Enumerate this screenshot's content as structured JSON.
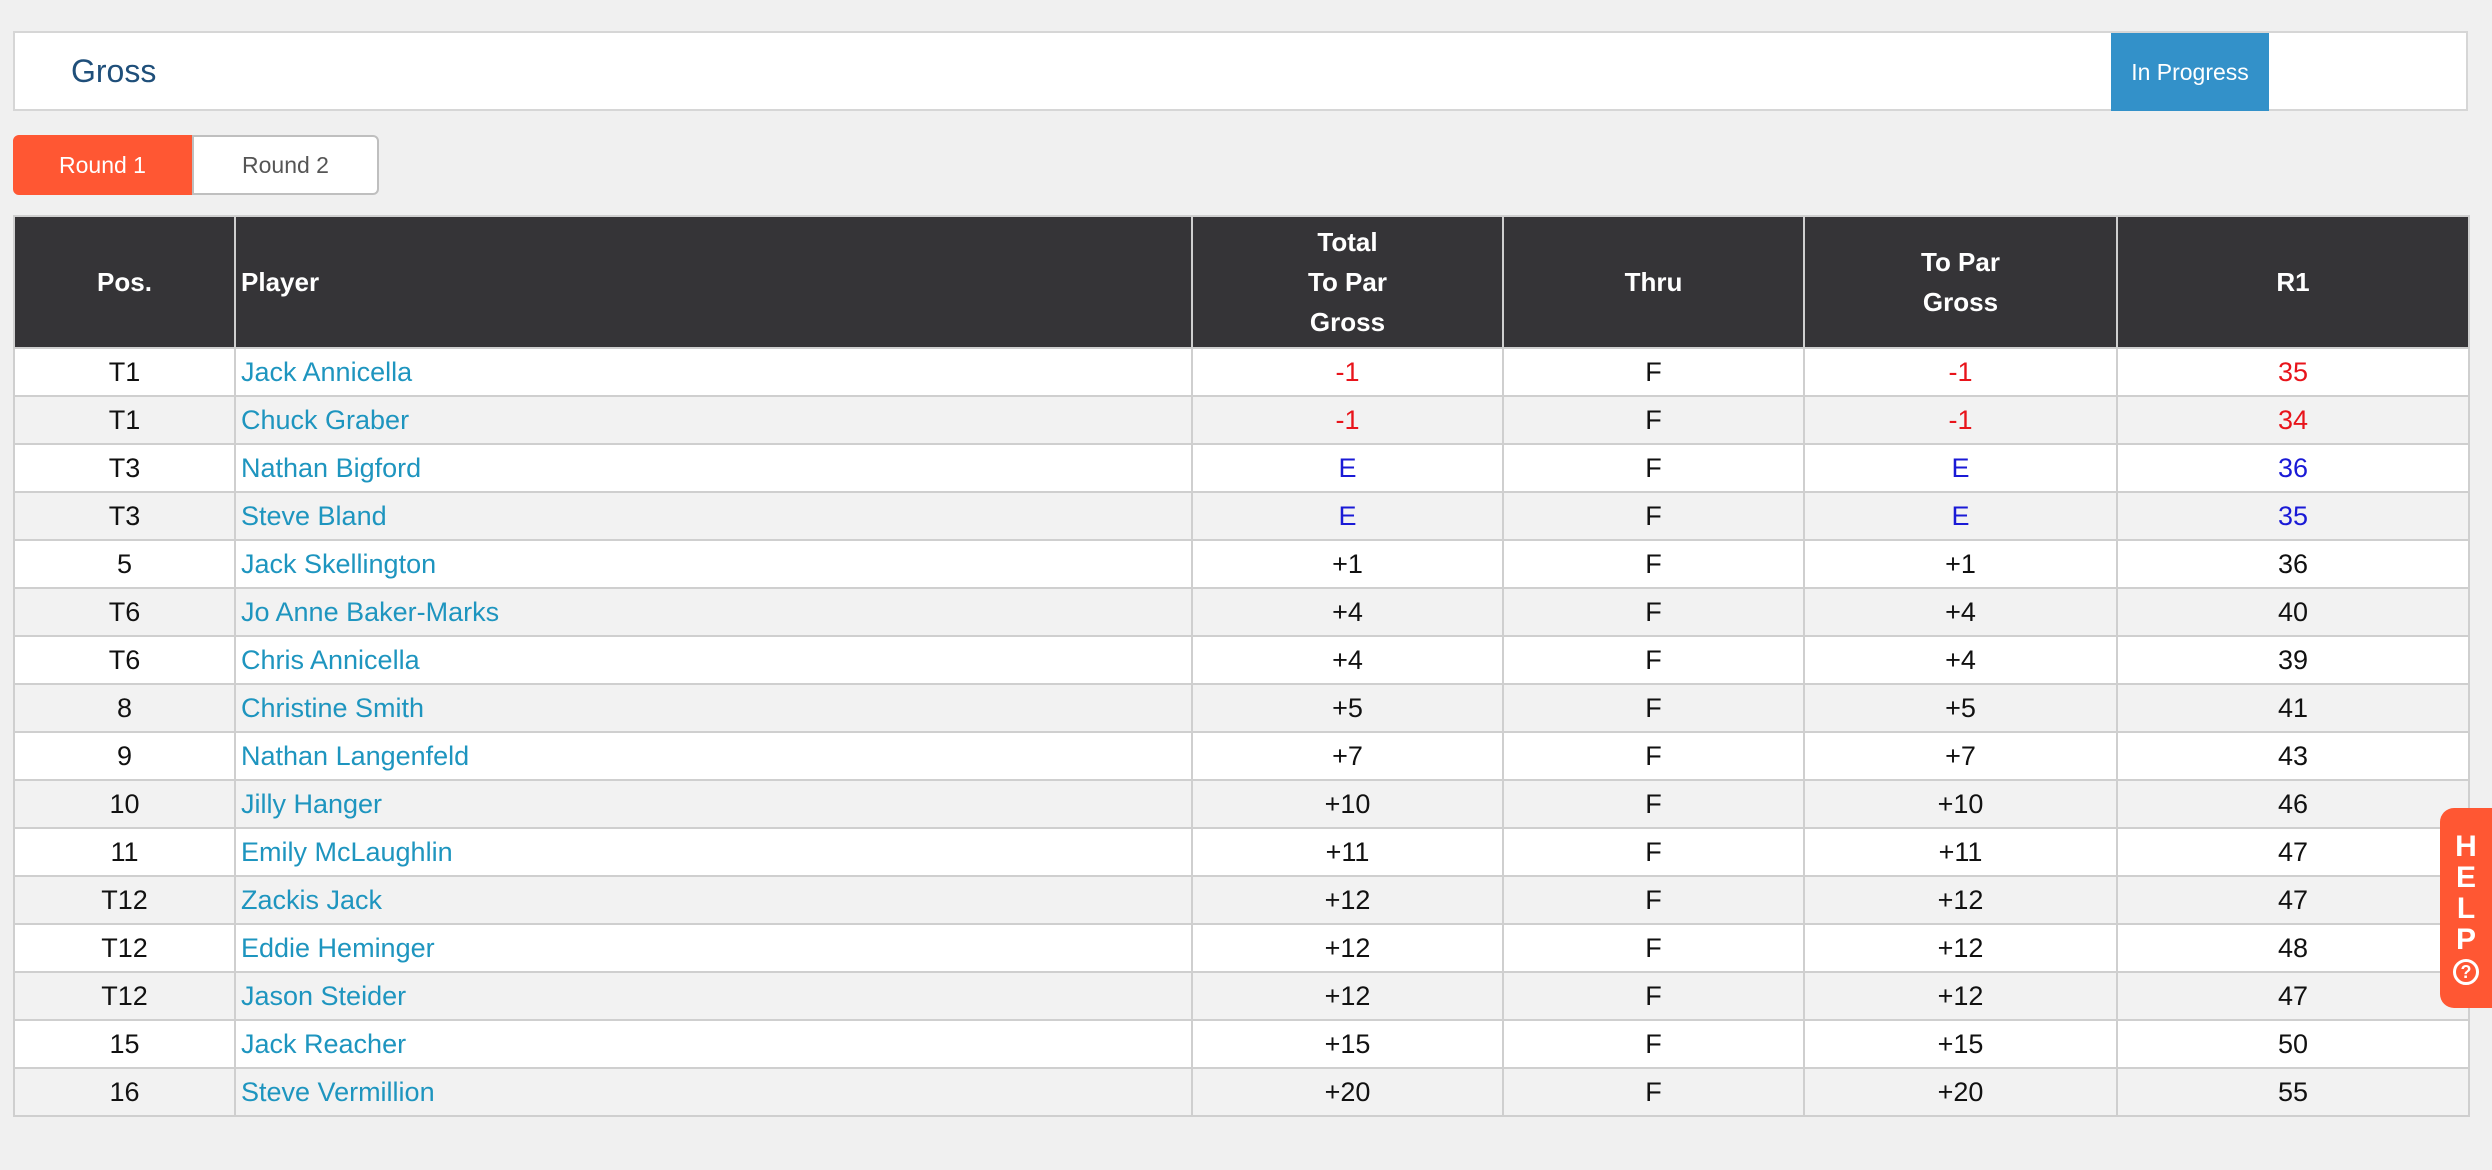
{
  "header": {
    "title": "Gross",
    "status": "In Progress"
  },
  "round_tabs": [
    {
      "label": "Round 1",
      "active": true
    },
    {
      "label": "Round 2",
      "active": false
    }
  ],
  "table": {
    "columns": {
      "pos": "Pos.",
      "player": "Player",
      "total_line1": "Total",
      "total_line2": "To Par",
      "total_line3": "Gross",
      "thru": "Thru",
      "topar_line1": "To Par",
      "topar_line2": "Gross",
      "r1": "R1"
    },
    "rows": [
      {
        "pos": "T1",
        "player": "Jack Annicella",
        "total": "-1",
        "thru": "F",
        "to_par": "-1",
        "r1": "35",
        "score_status": "under"
      },
      {
        "pos": "T1",
        "player": "Chuck Graber",
        "total": "-1",
        "thru": "F",
        "to_par": "-1",
        "r1": "34",
        "score_status": "under"
      },
      {
        "pos": "T3",
        "player": "Nathan Bigford",
        "total": "E",
        "thru": "F",
        "to_par": "E",
        "r1": "36",
        "score_status": "even"
      },
      {
        "pos": "T3",
        "player": "Steve Bland",
        "total": "E",
        "thru": "F",
        "to_par": "E",
        "r1": "35",
        "score_status": "even"
      },
      {
        "pos": "5",
        "player": "Jack Skellington",
        "total": "+1",
        "thru": "F",
        "to_par": "+1",
        "r1": "36",
        "score_status": "over"
      },
      {
        "pos": "T6",
        "player": "Jo Anne Baker-Marks",
        "total": "+4",
        "thru": "F",
        "to_par": "+4",
        "r1": "40",
        "score_status": "over"
      },
      {
        "pos": "T6",
        "player": "Chris Annicella",
        "total": "+4",
        "thru": "F",
        "to_par": "+4",
        "r1": "39",
        "score_status": "over"
      },
      {
        "pos": "8",
        "player": "Christine Smith",
        "total": "+5",
        "thru": "F",
        "to_par": "+5",
        "r1": "41",
        "score_status": "over"
      },
      {
        "pos": "9",
        "player": "Nathan Langenfeld",
        "total": "+7",
        "thru": "F",
        "to_par": "+7",
        "r1": "43",
        "score_status": "over"
      },
      {
        "pos": "10",
        "player": "Jilly Hanger",
        "total": "+10",
        "thru": "F",
        "to_par": "+10",
        "r1": "46",
        "score_status": "over"
      },
      {
        "pos": "11",
        "player": "Emily McLaughlin",
        "total": "+11",
        "thru": "F",
        "to_par": "+11",
        "r1": "47",
        "score_status": "over"
      },
      {
        "pos": "T12",
        "player": "Zackis Jack",
        "total": "+12",
        "thru": "F",
        "to_par": "+12",
        "r1": "47",
        "score_status": "over"
      },
      {
        "pos": "T12",
        "player": "Eddie Heminger",
        "total": "+12",
        "thru": "F",
        "to_par": "+12",
        "r1": "48",
        "score_status": "over"
      },
      {
        "pos": "T12",
        "player": "Jason Steider",
        "total": "+12",
        "thru": "F",
        "to_par": "+12",
        "r1": "47",
        "score_status": "over"
      },
      {
        "pos": "15",
        "player": "Jack Reacher",
        "total": "+15",
        "thru": "F",
        "to_par": "+15",
        "r1": "50",
        "score_status": "over"
      },
      {
        "pos": "16",
        "player": "Steve Vermillion",
        "total": "+20",
        "thru": "F",
        "to_par": "+20",
        "r1": "55",
        "score_status": "over"
      }
    ]
  },
  "score_colors": {
    "under": "#e8141b",
    "even": "#1a1ad6",
    "over": "#111111"
  },
  "help": {
    "letters": [
      "H",
      "E",
      "L",
      "P"
    ],
    "icon": "question-circle-icon",
    "icon_glyph": "?"
  }
}
